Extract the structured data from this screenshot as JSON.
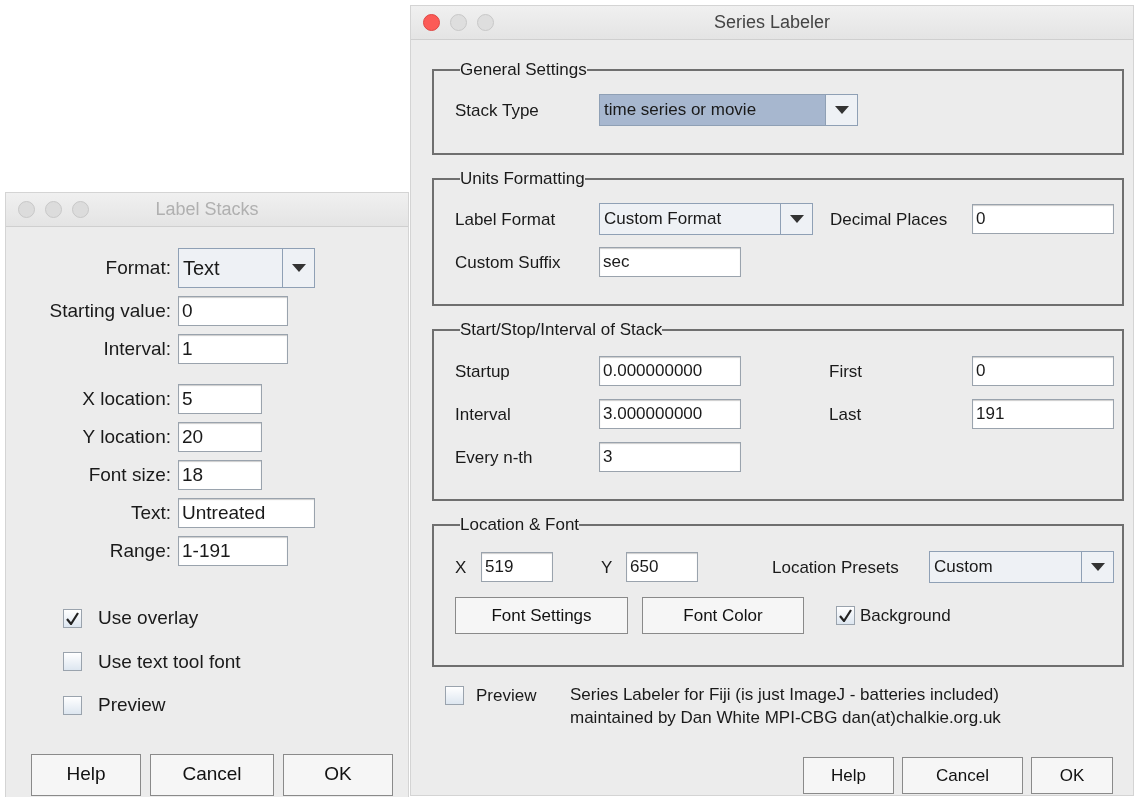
{
  "label_stacks": {
    "title": "Label Stacks",
    "active": false,
    "fields": [
      {
        "kind": "dropdown",
        "label": "Format:",
        "value": "Text"
      },
      {
        "kind": "text",
        "label": "Starting value:",
        "value": "0"
      },
      {
        "kind": "text",
        "label": "Interval:",
        "value": "1"
      },
      {
        "kind": "text",
        "label": "X location:",
        "value": "5"
      },
      {
        "kind": "text",
        "label": "Y location:",
        "value": "20"
      },
      {
        "kind": "text",
        "label": "Font size:",
        "value": "18"
      },
      {
        "kind": "text",
        "label": "Text:",
        "value": "Untreated"
      },
      {
        "kind": "text",
        "label": "Range:",
        "value": "1-191"
      }
    ],
    "checkboxes": [
      {
        "label": "Use overlay",
        "checked": true
      },
      {
        "label": "Use text tool font",
        "checked": false
      },
      {
        "label": "Preview",
        "checked": false
      }
    ],
    "buttons": [
      "Help",
      "Cancel",
      "OK"
    ]
  },
  "series_labeler": {
    "title": "Series Labeler",
    "active": true,
    "general_settings": {
      "legend": "General Settings",
      "stack_type": {
        "label": "Stack Type",
        "value": "time series or movie",
        "focused": true
      }
    },
    "units_formatting": {
      "legend": "Units Formatting",
      "label_format": {
        "label": "Label Format",
        "value": "Custom Format"
      },
      "decimal_places": {
        "label": "Decimal Places",
        "value": "0"
      },
      "custom_suffix": {
        "label": "Custom Suffix",
        "value": "sec"
      }
    },
    "start_stop_interval": {
      "legend": "Start/Stop/Interval of Stack",
      "fields": [
        {
          "label": "Startup",
          "value": "0.000000000"
        },
        {
          "label": "First",
          "value": "0"
        },
        {
          "label": "Interval",
          "value": "3.000000000"
        },
        {
          "label": "Last",
          "value": "191"
        },
        {
          "label": "Every n-th",
          "value": "3"
        }
      ]
    },
    "location_font": {
      "legend": "Location & Font",
      "x": {
        "label": "X",
        "value": "519"
      },
      "y": {
        "label": "Y",
        "value": "650"
      },
      "location_presets": {
        "label": "Location Presets",
        "value": "Custom"
      },
      "buttons": [
        "Font Settings",
        "Font Color"
      ],
      "background": {
        "label": "Background",
        "checked": true
      }
    },
    "preview": {
      "label": "Preview",
      "checked": false
    },
    "credits": [
      "Series Labeler for Fiji (is just ImageJ - batteries included)",
      "maintained by Dan White MPI-CBG dan(at)chalkie.org.uk"
    ],
    "buttons": [
      "Help",
      "Cancel",
      "OK"
    ]
  }
}
